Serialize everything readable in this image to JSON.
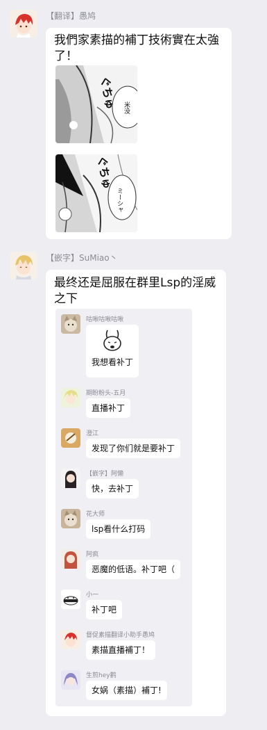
{
  "messages": [
    {
      "sender": "【翻译】愚鸠",
      "text": "我們家素描的補丁技術實在太強了！",
      "images": [
        {
          "icon": "manga-panel-1",
          "sfx": "ぐちゅ",
          "balloon": "米没"
        },
        {
          "icon": "manga-panel-2",
          "sfx": "ぐちゅ",
          "balloon": "ミーシャ"
        }
      ]
    },
    {
      "sender": "【嵌字】SuMiao丶",
      "text": "最终还是屈服在群里Lsp的淫威之下",
      "forwarded": [
        {
          "name": "咕啾咕啾咕啾",
          "text": "我想看补丁",
          "sticker": "rabbit-sticker"
        },
        {
          "name": "期盼粉头-五月",
          "text": "直播补丁"
        },
        {
          "name": "澄江",
          "text": "发现了你们就是要补丁"
        },
        {
          "name": "【嵌字】阿懒",
          "text": "快，去补丁"
        },
        {
          "name": "花大师",
          "text": "lsp看什么打码"
        },
        {
          "name": "阿疯",
          "text": "恶魔的低语。补丁吧（"
        },
        {
          "name": "小一",
          "text": "补丁吧"
        },
        {
          "name": "督促素描翻译小助手愚鸠",
          "text": "素描直播補丁！"
        },
        {
          "name": "生煎hey鹳",
          "text": "女娲（素描）補丁!"
        }
      ]
    }
  ]
}
